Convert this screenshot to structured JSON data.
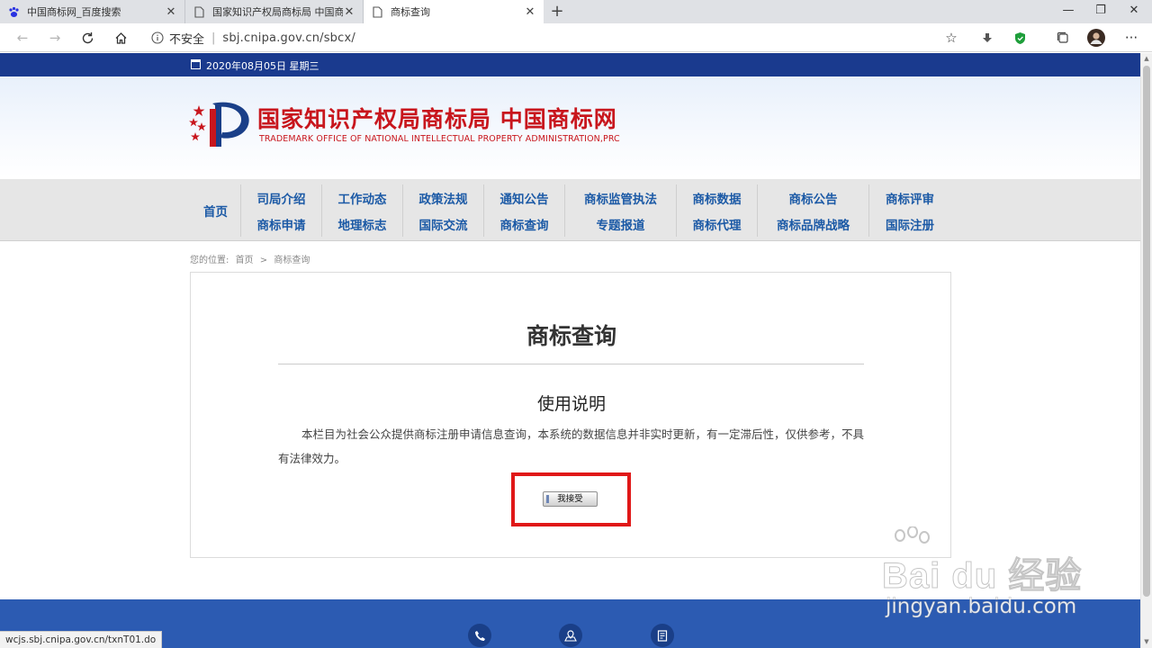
{
  "browser": {
    "tabs": [
      {
        "title": "中国商标网_百度搜索",
        "favicon": "paw-icon"
      },
      {
        "title": "国家知识产权局商标局 中国商标网",
        "favicon": "page-icon"
      },
      {
        "title": "商标查询",
        "favicon": "page-icon"
      }
    ],
    "new_tab": "+",
    "address": {
      "security_label": "不安全",
      "separator": "|",
      "url": "sbj.cnipa.gov.cn/sbcx/"
    },
    "status_url": "wcjs.sbj.cnipa.gov.cn/txnT01.do",
    "colors": {
      "tabbar": "#dfe1e5",
      "shield": "#1e9e3a"
    }
  },
  "site": {
    "date": "2020年08月05日 星期三",
    "logo_cn": "国家知识产权局商标局 中国商标网",
    "logo_en": "TRADEMARK OFFICE OF NATIONAL INTELLECTUAL PROPERTY ADMINISTRATION,PRC",
    "nav": [
      {
        "top": "首页",
        "bottom": ""
      },
      {
        "top": "司局介绍",
        "bottom": "商标申请"
      },
      {
        "top": "工作动态",
        "bottom": "地理标志"
      },
      {
        "top": "政策法规",
        "bottom": "国际交流"
      },
      {
        "top": "通知公告",
        "bottom": "商标查询"
      },
      {
        "top": "商标监管执法",
        "bottom": "专题报道"
      },
      {
        "top": "商标数据",
        "bottom": "商标代理"
      },
      {
        "top": "商标公告",
        "bottom": "商标品牌战略"
      },
      {
        "top": "商标评审",
        "bottom": "国际注册"
      }
    ],
    "breadcrumb": {
      "label": "您的位置:",
      "home": "首页",
      "sep": ">",
      "current": "商标查询"
    },
    "panel": {
      "title": "商标查询",
      "subtitle": "使用说明",
      "description": "本栏目为社会公众提供商标注册申请信息查询，本系统的数据信息并非实时更新，有一定滞后性，仅供参考，不具有法律效力。",
      "accept_button": "我接受"
    },
    "colors": {
      "datebar": "#1a3a8e",
      "brand_red": "#c8161d",
      "nav_text": "#1c5aa6",
      "footer": "#2c5bb2",
      "highlight": "#e01818"
    },
    "footer_icons": [
      "phone-icon",
      "map-icon",
      "document-icon"
    ]
  },
  "watermark": {
    "main": "Bai du 经验",
    "sub": "jingyan.baidu.com"
  }
}
